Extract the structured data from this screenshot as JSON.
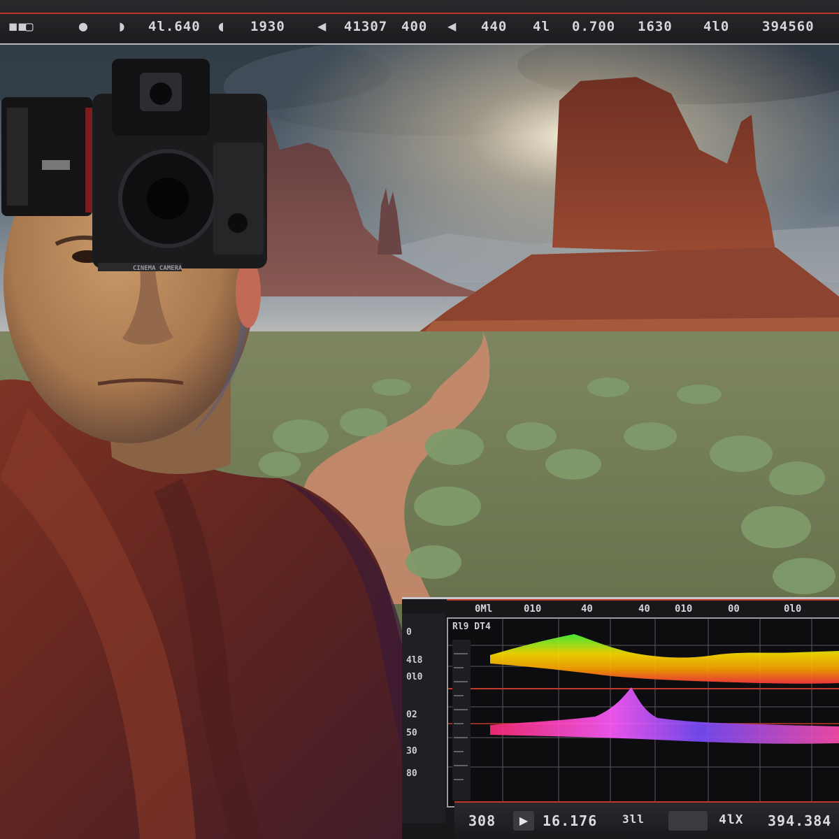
{
  "top_bar": {
    "readouts": [
      "4l.640",
      "1930",
      "41307",
      "400",
      "440",
      "4l",
      "0.700",
      "1630",
      "4l0",
      "394560"
    ],
    "glyphs": [
      "◼",
      "◗",
      "◖",
      "◀",
      "◀",
      "◀"
    ]
  },
  "camera": {
    "label": "CINEMA CAMERA"
  },
  "scope": {
    "title": "Rl9 DT4",
    "header_ticks": [
      "0Ml",
      "010",
      "40",
      "40",
      "010",
      "00",
      "0l0"
    ],
    "left_values": [
      "0",
      "4l8",
      "0l0",
      "02",
      "50",
      "30",
      "80"
    ],
    "colors": {
      "trace_top": [
        "#ff3b3b",
        "#ffa500",
        "#ffe000",
        "#4cff3a"
      ],
      "trace_bottom": [
        "#ff2d7a",
        "#ff5cff",
        "#7a4dff",
        "#3aa0ff"
      ]
    }
  },
  "bottom_bar": {
    "timecode_left": "308",
    "play_icon": "play-icon",
    "timecode_mid": "16.176",
    "label_a": "3ll",
    "label_b": "4lX",
    "timecode_right": "394.384"
  },
  "scene": {
    "sky_color": "#5d6b78",
    "rock_color": "#7a3a28",
    "robe_color": "#6d2a22"
  }
}
